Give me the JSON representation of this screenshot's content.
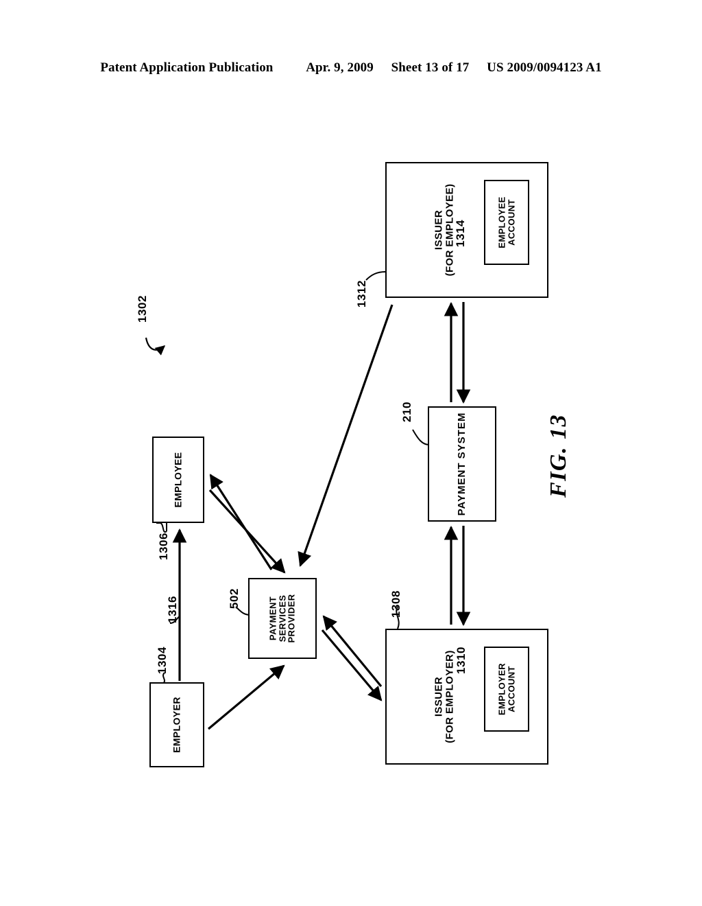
{
  "header": {
    "publication": "Patent Application Publication",
    "date": "Apr. 9, 2009",
    "sheet": "Sheet 13 of 17",
    "patent_number": "US 2009/0094123 A1"
  },
  "figure": {
    "caption": "FIG. 13",
    "diagram_ref": "1302"
  },
  "nodes": {
    "issuer_employee": {
      "line1": "ISSUER",
      "line2": "(FOR EMPLOYEE)",
      "ref": "1312"
    },
    "employee_account": {
      "line1": "EMPLOYEE",
      "line2": "ACCOUNT",
      "ref": "1314"
    },
    "employee": {
      "label": "EMPLOYEE",
      "ref": "1306"
    },
    "employer": {
      "label": "EMPLOYER",
      "ref": "1304"
    },
    "payment_services_provider": {
      "line1": "PAYMENT",
      "line2": "SERVICES",
      "line3": "PROVIDER",
      "ref": "502"
    },
    "payment_system": {
      "label": "PAYMENT  SYSTEM",
      "ref": "210"
    },
    "issuer_employer": {
      "line1": "ISSUER",
      "line2": "(FOR EMPLOYER)",
      "ref": "1308"
    },
    "employer_account": {
      "line1": "EMPLOYER",
      "line2": "ACCOUNT",
      "ref": "1310"
    }
  },
  "connectors": {
    "employer_to_employee": {
      "ref": "1316"
    }
  },
  "colors": {
    "ink": "#000000",
    "paper": "#ffffff"
  }
}
